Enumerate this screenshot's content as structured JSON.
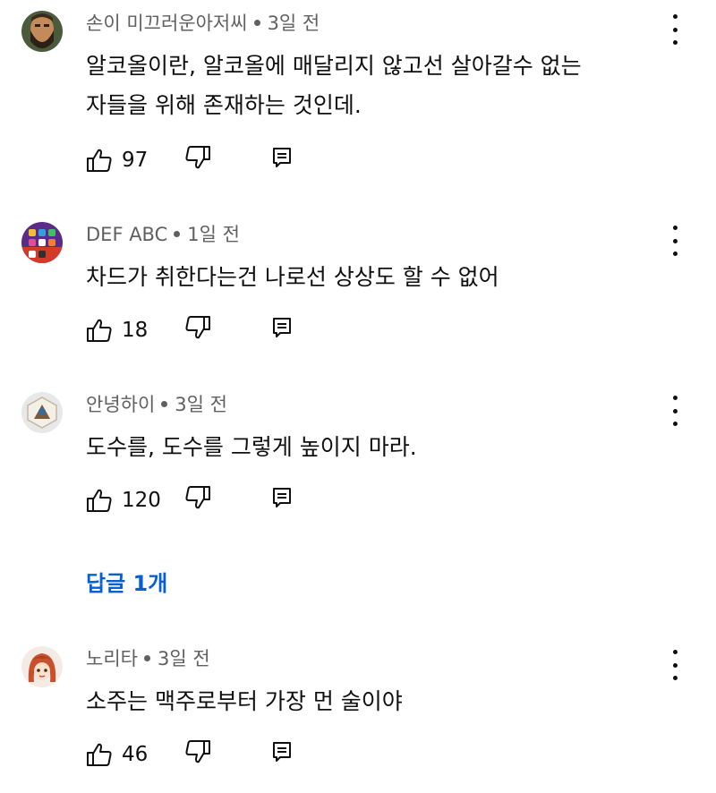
{
  "comments": [
    {
      "author": "손이 미끄러운아저씨",
      "time": "3일 전",
      "text_lines": [
        "알코올이란, 알코올에 매달리지 않고선 살아갈수 없는",
        "자들을 위해 존재하는 것인데."
      ],
      "likes": "97",
      "avatar_icon": "bearded-man-avatar"
    },
    {
      "author": "DEF ABC",
      "time": "1일 전",
      "text_lines": [
        "차드가 취한다는건 나로선 상상도 할 수 없어"
      ],
      "likes": "18",
      "avatar_icon": "phone-homescreen-avatar"
    },
    {
      "author": "안녕하이",
      "time": "3일 전",
      "text_lines": [
        "도수를, 도수를 그렇게 높이지 마라."
      ],
      "likes": "120",
      "avatar_icon": "hexagon-figure-avatar"
    },
    {
      "author": "노리타",
      "time": "3일 전",
      "text_lines": [
        "소주는 맥주로부터 가장 먼 술이야"
      ],
      "likes": "46",
      "avatar_icon": "anime-girl-avatar"
    }
  ],
  "replies_link": "답글 1개",
  "colors": {
    "meta": "#606060",
    "link": "#065fd4",
    "text": "#0f0f0f"
  }
}
